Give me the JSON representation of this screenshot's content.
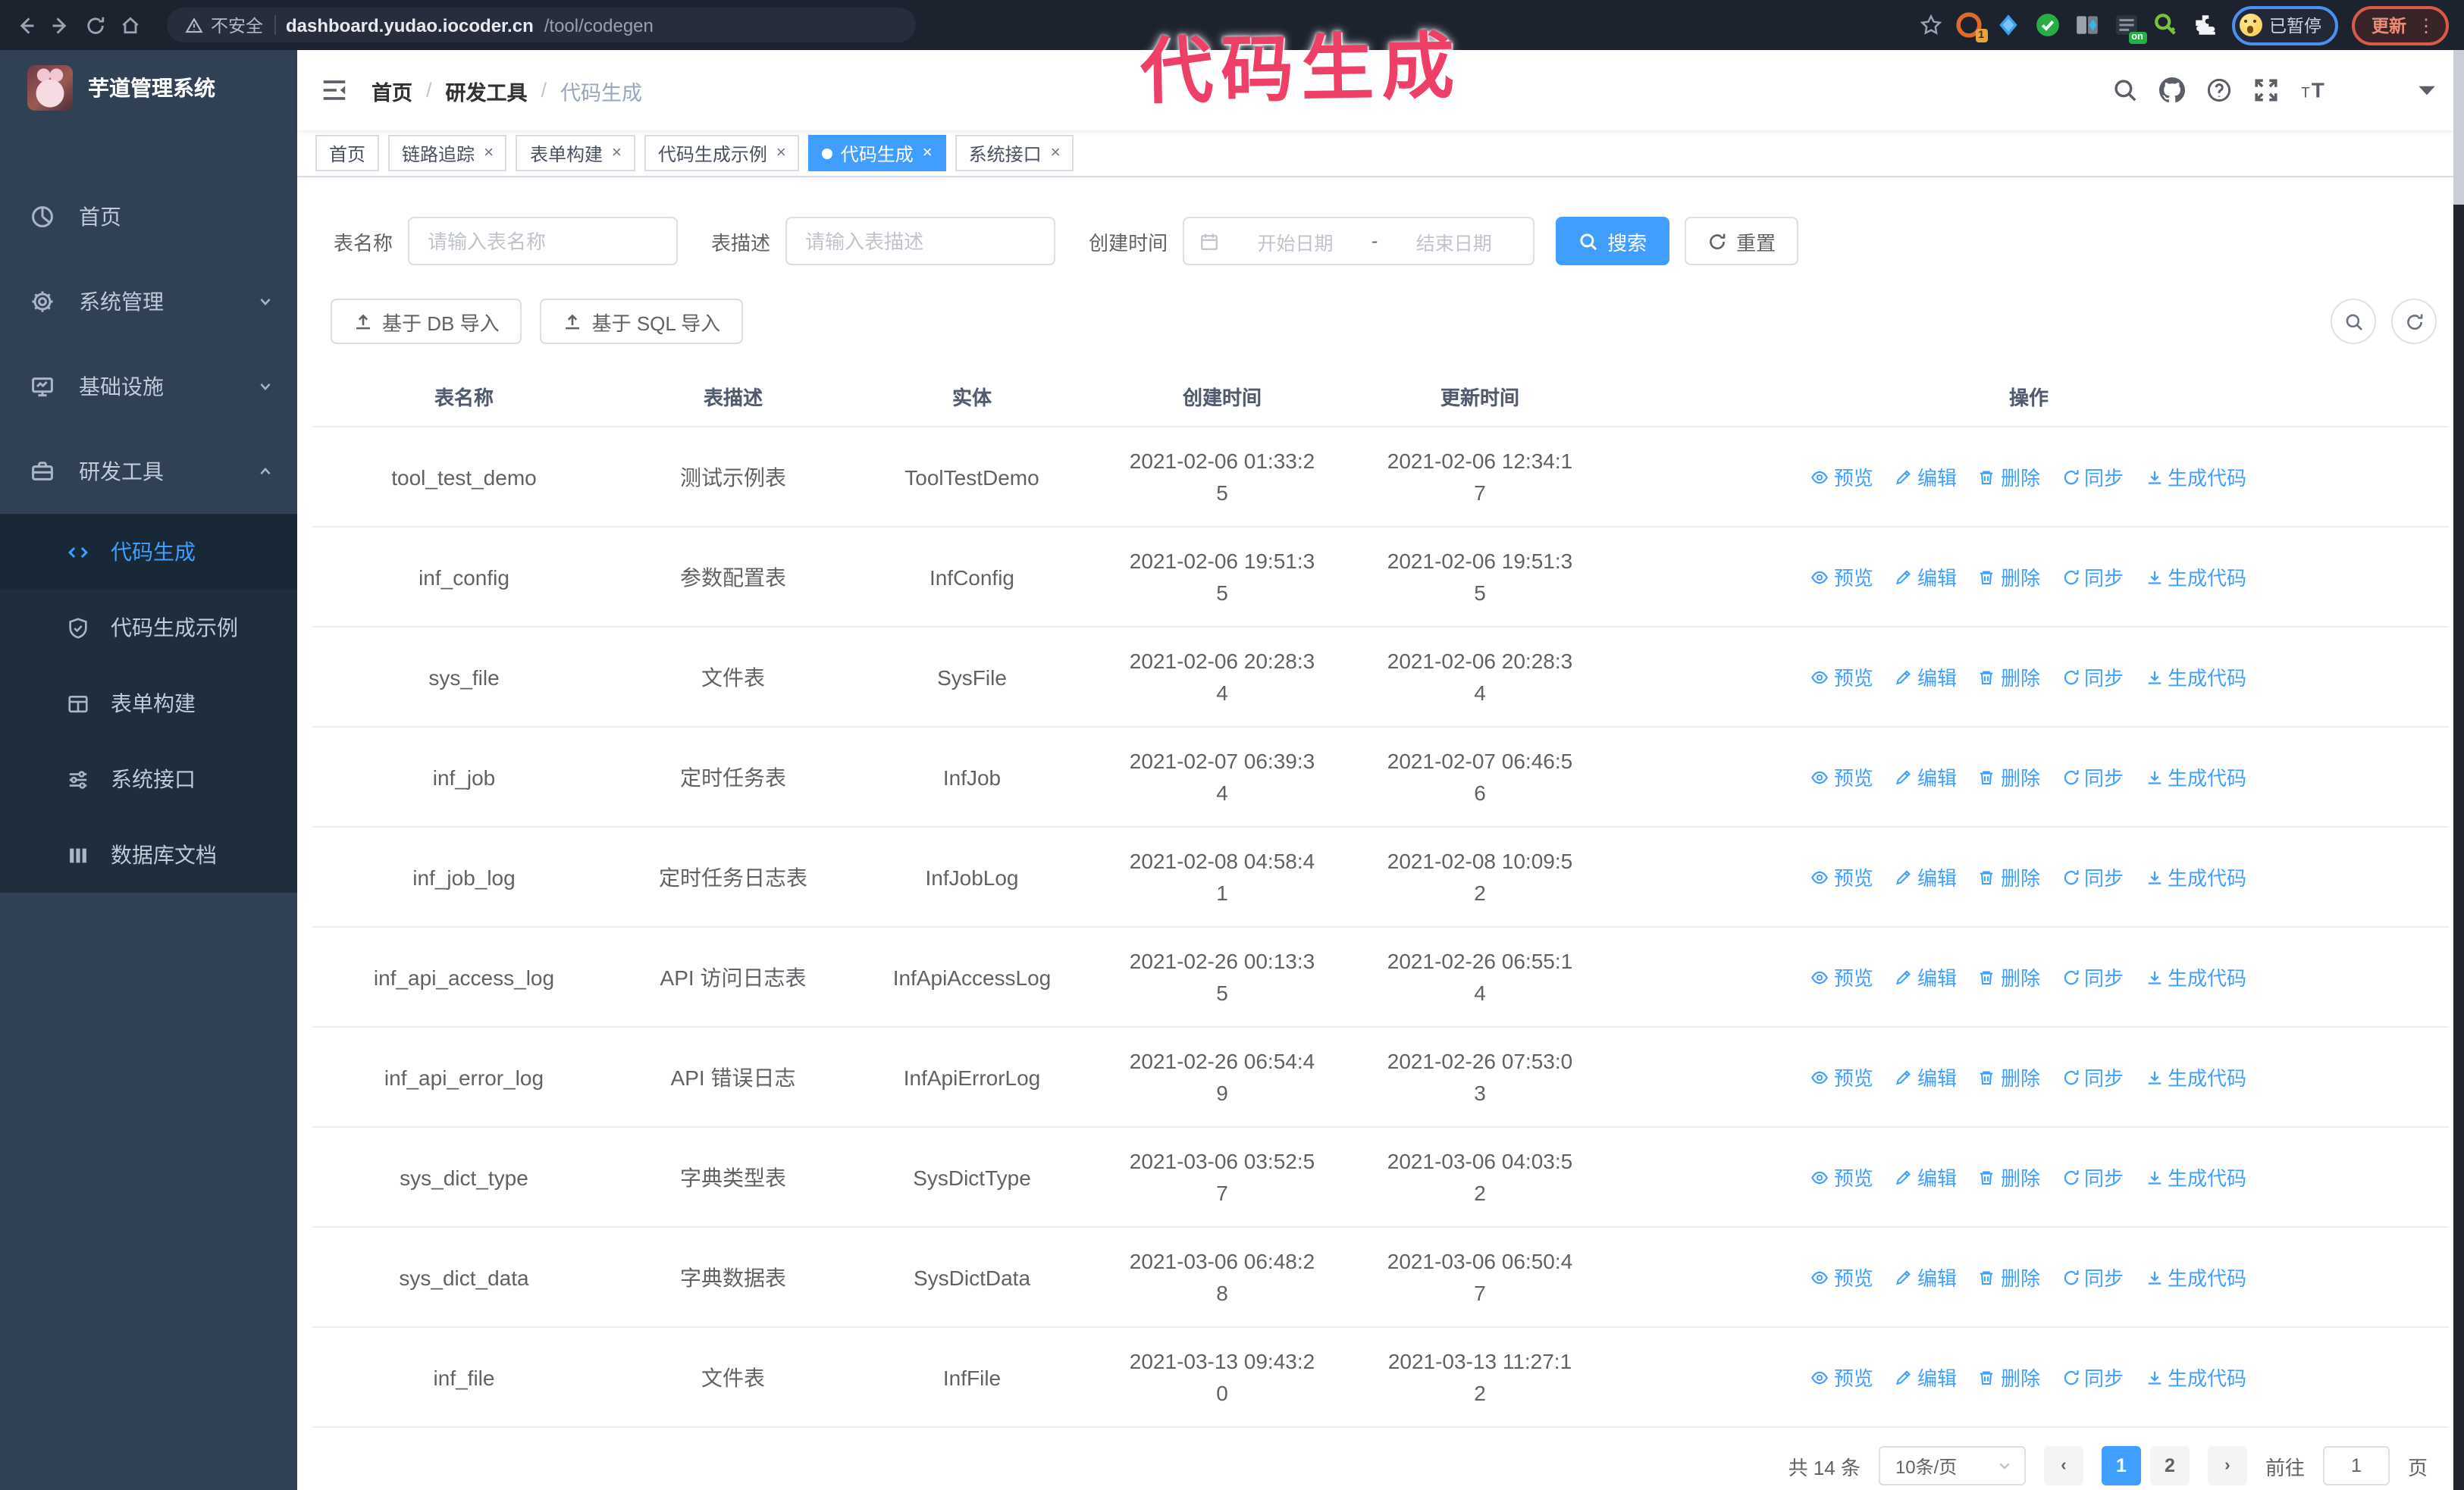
{
  "browser": {
    "security_label": "不安全",
    "url_host": "dashboard.yudao.iocoder.cn",
    "url_path": "/tool/codegen",
    "ext_badge_count": "1",
    "ext_on_badge": "on",
    "paused_badge": "已暂停",
    "update_label": "更新"
  },
  "overlay_title": "代码生成",
  "sidebar": {
    "logo_title": "芋道管理系统",
    "menu": [
      {
        "label": "首页",
        "icon": "dashboard-icon",
        "type": "link"
      },
      {
        "label": "系统管理",
        "icon": "gear-icon",
        "type": "group",
        "state": "collapsed"
      },
      {
        "label": "基础设施",
        "icon": "monitor-icon",
        "type": "group",
        "state": "collapsed"
      },
      {
        "label": "研发工具",
        "icon": "toolbox-icon",
        "type": "group",
        "state": "expanded",
        "children": [
          {
            "label": "代码生成",
            "icon": "code-icon",
            "active": true
          },
          {
            "label": "代码生成示例",
            "icon": "shield-check-icon",
            "active": false
          },
          {
            "label": "表单构建",
            "icon": "form-icon",
            "active": false
          },
          {
            "label": "系统接口",
            "icon": "sliders-icon",
            "active": false
          },
          {
            "label": "数据库文档",
            "icon": "columns-icon",
            "active": false
          }
        ]
      }
    ]
  },
  "navbar": {
    "breadcrumb": [
      "首页",
      "研发工具",
      "代码生成"
    ]
  },
  "tabs": [
    {
      "label": "首页",
      "closable": false,
      "active": false
    },
    {
      "label": "链路追踪",
      "closable": true,
      "active": false
    },
    {
      "label": "表单构建",
      "closable": true,
      "active": false
    },
    {
      "label": "代码生成示例",
      "closable": true,
      "active": false
    },
    {
      "label": "代码生成",
      "closable": true,
      "active": true
    },
    {
      "label": "系统接口",
      "closable": true,
      "active": false
    }
  ],
  "filters": {
    "name_label": "表名称",
    "name_placeholder": "请输入表名称",
    "desc_label": "表描述",
    "desc_placeholder": "请输入表描述",
    "time_label": "创建时间",
    "start_placeholder": "开始日期",
    "range_separator": "-",
    "end_placeholder": "结束日期",
    "search_label": "搜索",
    "reset_label": "重置"
  },
  "toolbar": {
    "db_import_label": "基于 DB 导入",
    "sql_import_label": "基于 SQL 导入"
  },
  "table": {
    "columns": [
      "表名称",
      "表描述",
      "实体",
      "创建时间",
      "更新时间",
      "操作"
    ],
    "row_actions": [
      {
        "label": "预览",
        "icon": "eye-icon"
      },
      {
        "label": "编辑",
        "icon": "edit-icon"
      },
      {
        "label": "删除",
        "icon": "delete-icon"
      },
      {
        "label": "同步",
        "icon": "sync-icon"
      },
      {
        "label": "生成代码",
        "icon": "download-icon"
      }
    ],
    "rows": [
      {
        "name": "tool_test_demo",
        "desc": "测试示例表",
        "entity": "ToolTestDemo",
        "created": "2021-02-06 01:33:25",
        "updated": "2021-02-06 12:34:17"
      },
      {
        "name": "inf_config",
        "desc": "参数配置表",
        "entity": "InfConfig",
        "created": "2021-02-06 19:51:35",
        "updated": "2021-02-06 19:51:35"
      },
      {
        "name": "sys_file",
        "desc": "文件表",
        "entity": "SysFile",
        "created": "2021-02-06 20:28:34",
        "updated": "2021-02-06 20:28:34"
      },
      {
        "name": "inf_job",
        "desc": "定时任务表",
        "entity": "InfJob",
        "created": "2021-02-07 06:39:34",
        "updated": "2021-02-07 06:46:56"
      },
      {
        "name": "inf_job_log",
        "desc": "定时任务日志表",
        "entity": "InfJobLog",
        "created": "2021-02-08 04:58:41",
        "updated": "2021-02-08 10:09:52"
      },
      {
        "name": "inf_api_access_log",
        "desc": "API 访问日志表",
        "entity": "InfApiAccessLog",
        "created": "2021-02-26 00:13:35",
        "updated": "2021-02-26 06:55:14"
      },
      {
        "name": "inf_api_error_log",
        "desc": "API 错误日志",
        "entity": "InfApiErrorLog",
        "created": "2021-02-26 06:54:49",
        "updated": "2021-02-26 07:53:03"
      },
      {
        "name": "sys_dict_type",
        "desc": "字典类型表",
        "entity": "SysDictType",
        "created": "2021-03-06 03:52:57",
        "updated": "2021-03-06 04:03:52"
      },
      {
        "name": "sys_dict_data",
        "desc": "字典数据表",
        "entity": "SysDictData",
        "created": "2021-03-06 06:48:28",
        "updated": "2021-03-06 06:50:47"
      },
      {
        "name": "inf_file",
        "desc": "文件表",
        "entity": "InfFile",
        "created": "2021-03-13 09:43:20",
        "updated": "2021-03-13 11:27:12"
      }
    ]
  },
  "pagination": {
    "total_text": "共 14 条",
    "page_size_text": "10条/页",
    "prev": "‹",
    "next": "›",
    "pages": [
      "1",
      "2"
    ],
    "active_page": "1",
    "goto_label": "前往",
    "goto_value": "1",
    "goto_suffix": "页"
  },
  "colors": {
    "accent": "#409eff",
    "overlay": "#ee3f66",
    "sidebar_bg": "#304156",
    "submenu_bg": "#1f2d3d",
    "chrome_bg": "#1d222f"
  }
}
